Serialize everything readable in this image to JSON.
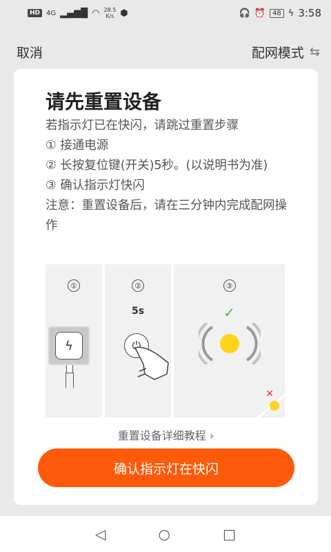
{
  "status": {
    "hd": "HD",
    "network": "4G",
    "speed_value": "28.5",
    "speed_unit": "K/s",
    "battery": "48",
    "time": "3:58"
  },
  "nav": {
    "cancel": "取消",
    "mode": "配网模式"
  },
  "card": {
    "title": "请先重置设备",
    "lines": [
      "若指示灯已在快闪，请跳过重置步骤",
      "① 接通电源",
      "② 长按复位键(开关)5秒。(以说明书为准)",
      "③ 确认指示灯快闪",
      "注意：重置设备后，请在三分钟内完成配网操作"
    ],
    "steps": [
      "①",
      "②",
      "③"
    ],
    "press_duration": "5s",
    "tutorial_link": "重置设备详细教程",
    "confirm_button": "确认指示灯在快闪"
  },
  "icons": {
    "swap": "swap-arrows-icon",
    "plug": "power-plug-icon",
    "power": "power-button-icon",
    "check": "check-icon",
    "cross": "cross-icon",
    "back": "back-triangle-icon",
    "home": "home-circle-icon",
    "recent": "recent-square-icon"
  },
  "colors": {
    "accent": "#ff5a0a",
    "indicator": "#ffd31a",
    "success": "#3bbf3b",
    "error": "#e33333"
  }
}
